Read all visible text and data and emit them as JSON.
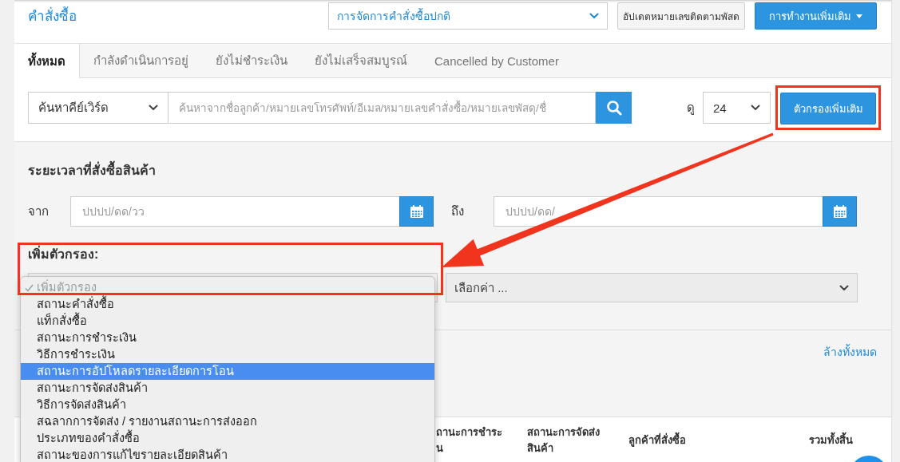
{
  "header": {
    "title": "คำสั่งซื้อ",
    "mode_select": {
      "value": "การจัดการคำสั่งซื้อปกติ"
    },
    "buttons": [
      {
        "label": "อัปเดตหมายเลขติดตามพัสด",
        "kind": "default",
        "menu": false
      },
      {
        "label": "การทำงานเพิ่มเติม",
        "kind": "primary",
        "menu": true
      }
    ]
  },
  "tabs": [
    {
      "label": "ทั้งหมด",
      "selected": true
    },
    {
      "label": "กำลังดำเนินการอยู่",
      "selected": false
    },
    {
      "label": "ยังไม่ชำระเงิน",
      "selected": false
    },
    {
      "label": "ยังไม่เสร็จสมบูรณ์",
      "selected": false
    },
    {
      "label": "Cancelled by Customer",
      "selected": false
    }
  ],
  "search": {
    "field_select": {
      "value": "ค้นหาคีย์เวิร์ด"
    },
    "placeholder": "ค้นหาจากชื่อลูกค้า/หมายเลขโทรศัพท์/อีเมล/หมายเลขคำสั่งซื้อ/หมายเลขพัสดุ/ชื่",
    "view_label": "ดู",
    "page_size": {
      "value": "24"
    },
    "filters_button": {
      "label": "ตัวกรองเพิ่มเติม",
      "highlighted": true
    }
  },
  "filter_panel": {
    "date_title": "ระยะเวลาที่สั่งซื้อสินค้า",
    "date_fields": [
      {
        "label": "จาก",
        "placeholder": "ปปปป/ดด/วว"
      },
      {
        "label": "ถึง",
        "placeholder": "ปปปป/ดด/"
      }
    ],
    "add_filter": {
      "title": "เพิ่มตัวกรอง:",
      "highlighted": true,
      "options": [
        {
          "label": "เพิ่มตัวกรอง",
          "checked": true,
          "disabled": true,
          "selected": false
        },
        {
          "label": "สถานะคำสั่งซื้อ",
          "checked": false,
          "disabled": false,
          "selected": false
        },
        {
          "label": "แท็กสั่งซื้อ",
          "checked": false,
          "disabled": false,
          "selected": false
        },
        {
          "label": "สถานะการชำระเงิน",
          "checked": false,
          "disabled": false,
          "selected": false
        },
        {
          "label": "วิธีการชำระเงิน",
          "checked": false,
          "disabled": false,
          "selected": false
        },
        {
          "label": "สถานะการอัปโหลดรายละเอียดการโอน",
          "checked": false,
          "disabled": false,
          "selected": true
        },
        {
          "label": "สถานะการจัดส่งสินค้า",
          "checked": false,
          "disabled": false,
          "selected": false
        },
        {
          "label": "วิธีการจัดส่งสินค้า",
          "checked": false,
          "disabled": false,
          "selected": false
        },
        {
          "label": "สฉลากการจัดส่ง / รายงานสถานะการส่งออก",
          "checked": false,
          "disabled": false,
          "selected": false
        },
        {
          "label": "ประเภทของคำสั่งซื้อ",
          "checked": false,
          "disabled": false,
          "selected": false
        },
        {
          "label": "สถานะของการแก้ไขรายละเอียดสินค้า",
          "checked": false,
          "disabled": false,
          "selected": false
        }
      ]
    },
    "value_select": {
      "placeholder": "เลือกค่า ..."
    },
    "clear_all": "ล้างทั้งหมด"
  },
  "table": {
    "columns": [
      {
        "lines": [
          "ถานะการชำระ",
          "น"
        ]
      },
      {
        "lines": [
          "สถานะการจัดส่ง",
          "สินค้า"
        ]
      },
      {
        "lines": [
          "ลูกค้าที่สั่งซื้อ"
        ]
      },
      {
        "lines": [
          "รวมทั้งสิ้น"
        ]
      }
    ]
  }
}
